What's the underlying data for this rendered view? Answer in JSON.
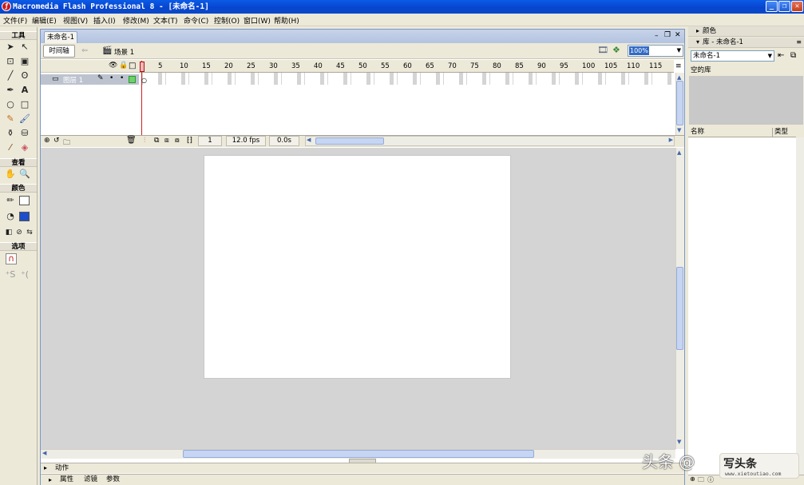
{
  "window": {
    "title": "Macromedia Flash Professional 8 - [未命名-1]"
  },
  "menu": [
    "文件(F)",
    "编辑(E)",
    "视图(V)",
    "插入(I)",
    "修改(M)",
    "文本(T)",
    "命令(C)",
    "控制(O)",
    "窗口(W)",
    "帮助(H)"
  ],
  "tools": {
    "section_tools": "工具",
    "section_view": "查看",
    "section_colors": "颜色",
    "section_options": "选项"
  },
  "document": {
    "tab": "未命名-1",
    "timeline_button": "时间轴",
    "scene": "场景 1",
    "zoom": "100%"
  },
  "timeline": {
    "layer_name": "图层 1",
    "ruler": [
      "1",
      "5",
      "10",
      "15",
      "20",
      "25",
      "30",
      "35",
      "40",
      "45",
      "50",
      "55",
      "60",
      "65",
      "70",
      "75",
      "80",
      "85",
      "90",
      "95",
      "100",
      "105",
      "110",
      "115"
    ],
    "current_frame": "1",
    "frame_rate": "12.0 fps",
    "elapsed": "0.0s"
  },
  "panels": {
    "actions": "动作",
    "properties": "属性",
    "filters": "滤镜",
    "parameters": "参数",
    "color": "颜色",
    "library_title": "库 - 未命名-1",
    "library_doc": "未命名-1",
    "library_status": "空的库",
    "col_name": "名称",
    "col_type": "类型"
  },
  "watermark": {
    "text": "头条 @",
    "badge": "写头条",
    "url": "www.xietoutiao.com"
  }
}
